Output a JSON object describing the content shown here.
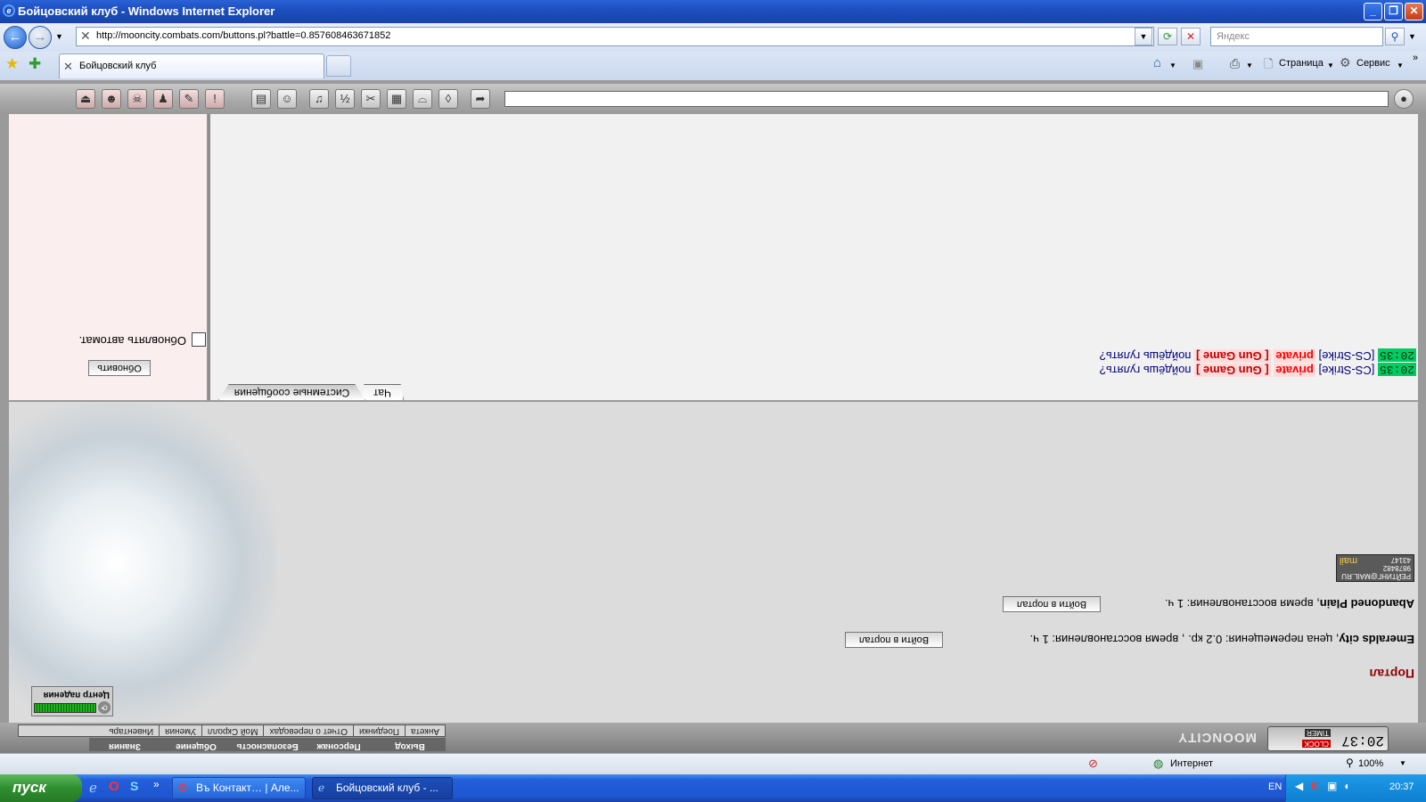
{
  "window": {
    "title": "Бойцовский клуб - Windows Internet Explorer"
  },
  "address_bar": {
    "url": "http://mooncity.combats.com/buttons.pl?battle=0.857608463671852"
  },
  "search_box": {
    "placeholder": "Яндекс"
  },
  "tabs": [
    {
      "label": "Бойцовский клуб"
    }
  ],
  "command_bar": {
    "page_label": "Страница",
    "tools_label": "Сервис"
  },
  "chat": {
    "tabs": [
      "Чат",
      "Системные сообщения"
    ],
    "lines": [
      {
        "time": "20:35",
        "source": "[CS-Strike]",
        "private": "private",
        "tag": "[ Gun Game ]",
        "text": "пойдёшь гулять?"
      },
      {
        "time": "20:35",
        "source": "[CS-Strike]",
        "private": "private",
        "tag": "[ Gun Game ]",
        "text": "пойдёшь гулять?"
      }
    ]
  },
  "left_panel": {
    "auto_refresh_label": "Обновлять автомат.",
    "refresh_button": "Обновить"
  },
  "portal": {
    "title": "Портал",
    "destinations": [
      {
        "name": "Emeralds city",
        "info": ", цена перемещения: 0.2 кр. , время восстановления: 1 ч.",
        "button": "Войти в портал"
      },
      {
        "name": "Abandoned Plain",
        "info": ", время восстановления: 1 ч.",
        "button": "Войти в портал"
      }
    ]
  },
  "counter": {
    "line1": "РЕЙТИНГ@MAIL.RU",
    "line2": "9878482",
    "line3": "43147",
    "logo": "mail"
  },
  "fall_center": {
    "label": "Центр падения"
  },
  "bottom_menu": {
    "row1": [
      "Инвентарь",
      "Умения",
      "Мой Скролл",
      "Отчет о переводах",
      "Поединки",
      "Анкета"
    ],
    "row2": [
      "Знания",
      "Общение",
      "Безопасность",
      "Персонаж",
      "Выход"
    ]
  },
  "game_clock": {
    "time": "20:37",
    "label1": "CLOCK",
    "label2": "TIMER",
    "brand": "MOONCITY"
  },
  "status_bar": {
    "zone": "Интернет",
    "zoom": "100%"
  },
  "taskbar": {
    "start": "пуск",
    "tasks": [
      "Въ Контакт… | Але...",
      "Бойцовский клуб - ..."
    ],
    "lang": "EN",
    "clock": "20:37"
  }
}
